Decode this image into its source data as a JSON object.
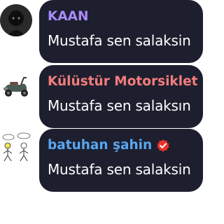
{
  "messages": [
    {
      "author": "KAAN",
      "author_color": "#a78bfa",
      "text": "Mustafa sen salaksin",
      "avatar": "dark-portrait-avatar",
      "verified": false
    },
    {
      "author": "Külüstür Motorsiklet",
      "author_color": "#f47c7c",
      "text": "Mustafa sen salaksın",
      "avatar": "scooter-avatar",
      "verified": false
    },
    {
      "author": "batuhan şahin",
      "author_color": "#5aa6f0",
      "text": "Mustafa sen salaksin",
      "avatar": "stick-figure-avatar",
      "verified": true,
      "badge_color": "#e8332c"
    }
  ],
  "colors": {
    "bubble": "#1d1f2e",
    "message_text": "#ffffff",
    "background": "#ffffff"
  }
}
